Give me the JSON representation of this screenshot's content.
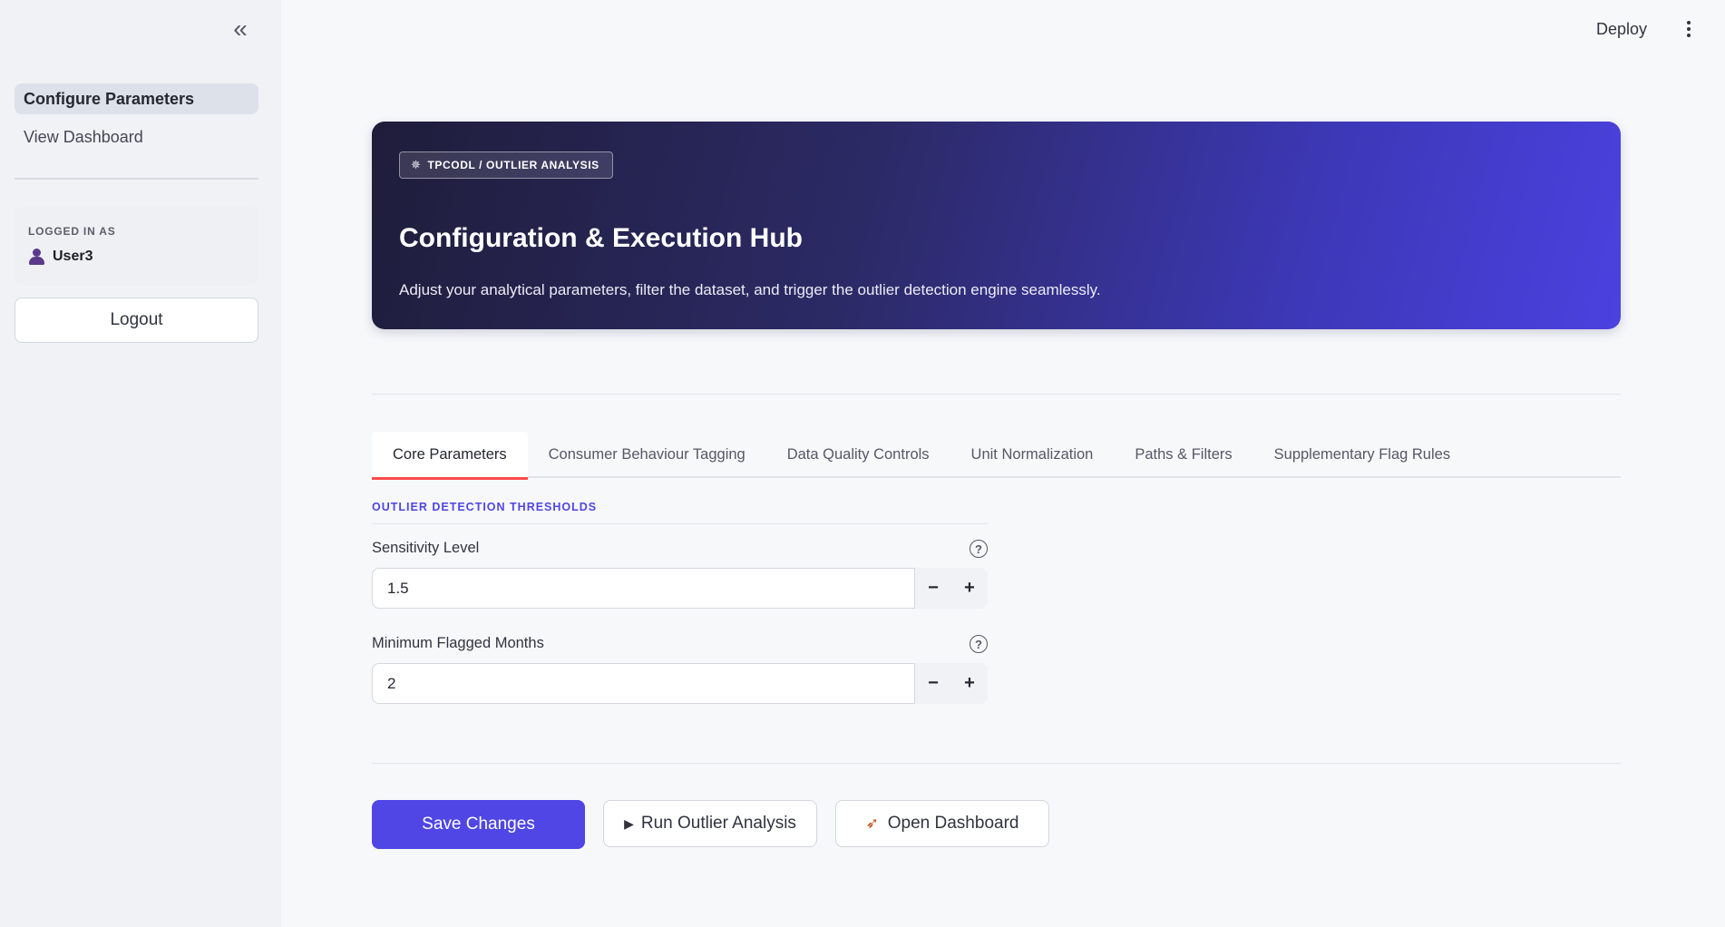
{
  "sidebar": {
    "items": [
      {
        "label": "Configure Parameters"
      },
      {
        "label": "View Dashboard"
      }
    ],
    "user": {
      "label": "LOGGED IN AS",
      "name": "User3"
    },
    "logout_label": "Logout"
  },
  "header": {
    "deploy_label": "Deploy"
  },
  "hero": {
    "badge": "TPCODL / OUTLIER ANALYSIS",
    "title": "Configuration & Execution Hub",
    "subtitle": "Adjust your analytical parameters, filter the dataset, and trigger the outlier detection engine seamlessly."
  },
  "tabs": [
    {
      "label": "Core Parameters"
    },
    {
      "label": "Consumer Behaviour Tagging"
    },
    {
      "label": "Data Quality Controls"
    },
    {
      "label": "Unit Normalization"
    },
    {
      "label": "Paths & Filters"
    },
    {
      "label": "Supplementary Flag Rules"
    }
  ],
  "form": {
    "section_title": "OUTLIER DETECTION THRESHOLDS",
    "fields": [
      {
        "label": "Sensitivity Level",
        "value": "1.5"
      },
      {
        "label": "Minimum Flagged Months",
        "value": "2"
      }
    ],
    "minus": "−",
    "plus": "+",
    "help": "?"
  },
  "actions": {
    "save_label": "Save Changes",
    "run_label": "Run Outlier Analysis",
    "dashboard_label": "Open Dashboard"
  },
  "icons": {
    "collapse": "chevrons-left-icon",
    "gear": "gear-icon",
    "user": "user-icon",
    "play": "play-icon",
    "rocket": "rocket-icon",
    "more": "more-vertical-icon"
  },
  "colors": {
    "accent": "#4f46e5",
    "tab_indicator": "#ff4b4b",
    "sidebar_bg": "#f0f2f6"
  }
}
